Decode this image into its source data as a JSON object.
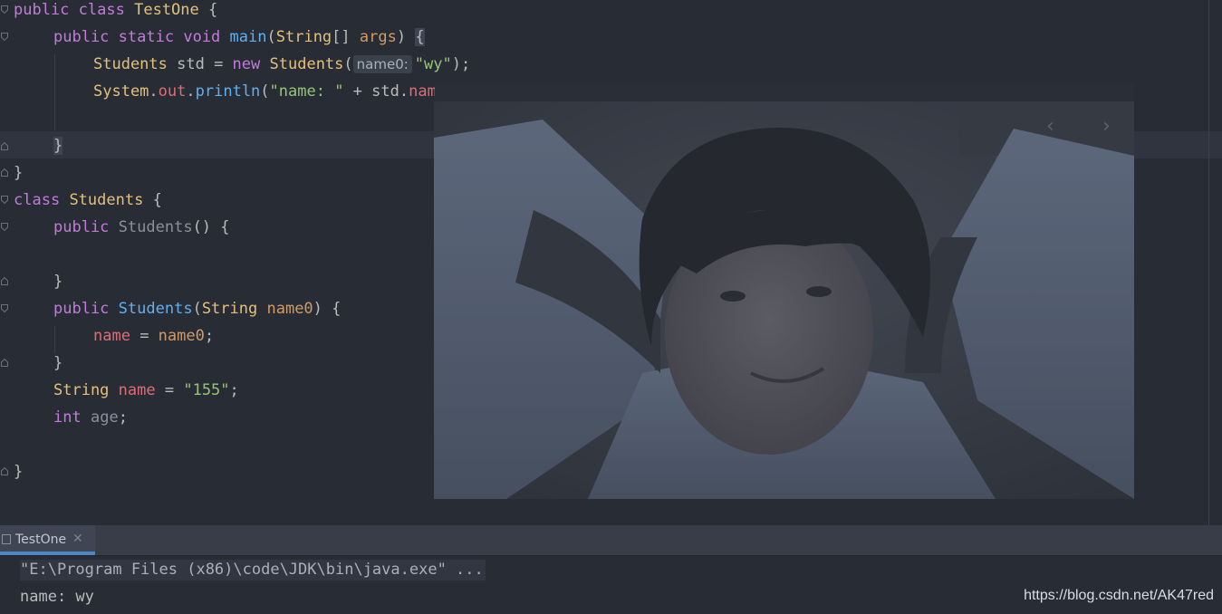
{
  "code": {
    "l1": {
      "kw1": "public",
      "kw2": "class",
      "cls": "TestOne",
      "p": " {"
    },
    "l2": {
      "kw1": "public",
      "kw2": "static",
      "kw3": "void",
      "fn": "main",
      "p1": "(",
      "type": "String",
      "p2": "[] ",
      "param": "args",
      "p3": ") ",
      "brace": "{"
    },
    "l3": {
      "cls": "Students",
      "p1": " std = ",
      "kw": "new",
      "cls2": "Students",
      "p2": "(",
      "hint": "name0:",
      "str": "\"wy\"",
      "p3": ");"
    },
    "l4": {
      "cls": "System",
      "p1": ".",
      "fld": "out",
      "p2": ".",
      "fn": "println",
      "p3": "(",
      "str": "\"name: \"",
      "p4": " + std.",
      "fld2": "name",
      "p5": ");"
    },
    "l6": {
      "brace": "}"
    },
    "l7": {
      "p": "}"
    },
    "l8": {
      "kw": "class",
      "cls": "Students",
      "p": " {"
    },
    "l9": {
      "kw": "public",
      "dim": "Students",
      "p": "() {"
    },
    "l11": {
      "p": "}"
    },
    "l12": {
      "kw": "public",
      "fn": "Students",
      "p1": "(",
      "type": "String",
      "param": "name0",
      "p2": ") {"
    },
    "l13": {
      "fld": "name",
      "p1": " = ",
      "par": "name0",
      "p2": ";"
    },
    "l14": {
      "p": "}"
    },
    "l15": {
      "type": "String",
      "fld": "name",
      "p1": " = ",
      "str": "\"155\"",
      "p2": ";"
    },
    "l16": {
      "kw": "int",
      "dim": "age",
      "p": ";"
    },
    "l18": {
      "p": "}"
    }
  },
  "run_panel": {
    "tab_label": "TestOne",
    "tab_close": "✕",
    "command": "\"E:\\Program Files (x86)\\code\\JDK\\bin\\java.exe\" ...",
    "output": "name: wy"
  },
  "overlay": {
    "prev_arrow": "‹",
    "next_arrow": "›"
  },
  "watermark": "https://blog.csdn.net/AK47red",
  "colors": {
    "background": "#282c34",
    "keyword": "#c679dd",
    "class": "#e5c07b",
    "function": "#61afef",
    "string": "#98c379",
    "field": "#e06c75",
    "accent": "#4a88c7"
  }
}
